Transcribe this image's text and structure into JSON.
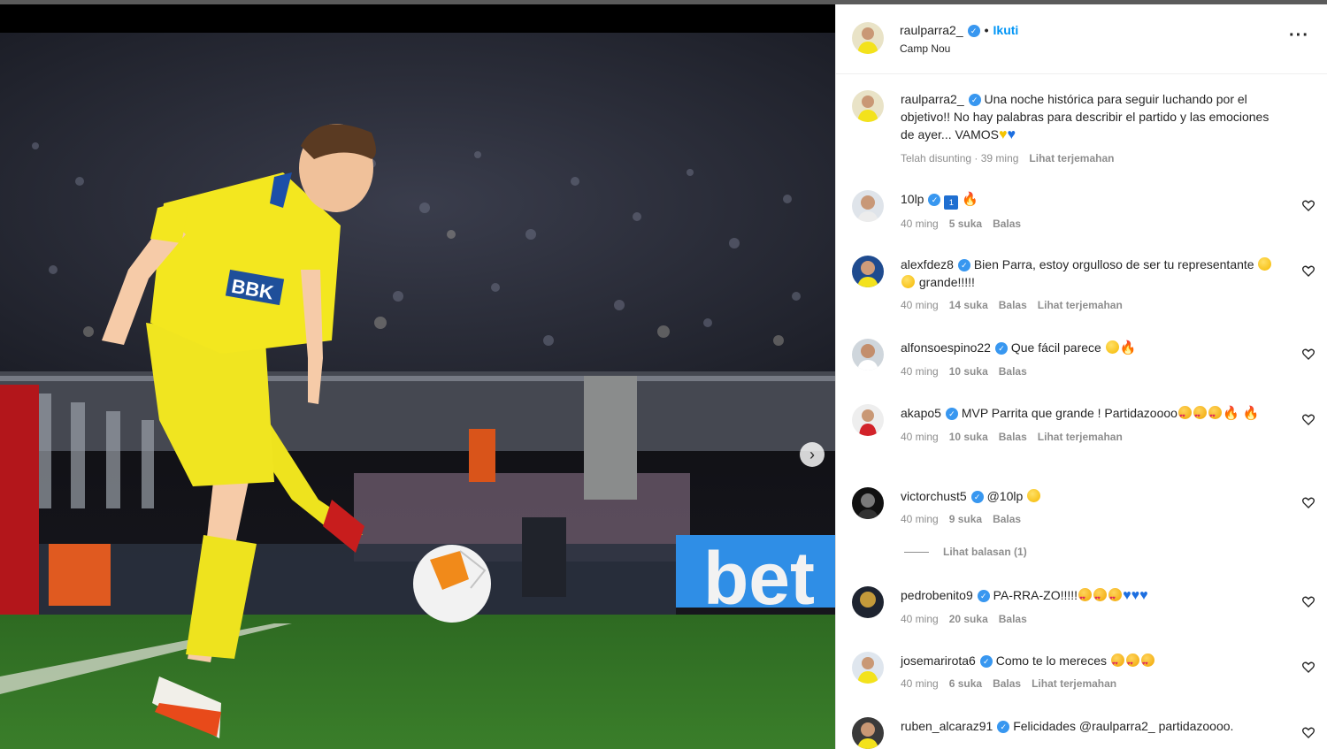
{
  "post": {
    "username": "raulparra2_",
    "follow_label": "Ikuti",
    "location": "Camp Nou",
    "caption": "Una noche histórica para seguir luchando por el objetivo!! No hay palabras para describir el partido y las emociones de ayer... VAMOS",
    "caption_meta_edited": "Telah disunting · 39 ming",
    "caption_translate": "Lihat terjemahan"
  },
  "media": {
    "next_icon": "chevron-right-icon",
    "sponsor_text": "bet"
  },
  "comments": [
    {
      "user": "10lp",
      "text": "",
      "time": "40 ming",
      "likes": "5 suka",
      "reply": "Balas",
      "translate": ""
    },
    {
      "user": "alexfdez8",
      "text": "Bien Parra, estoy orgulloso de ser tu representante",
      "text2": "grande!!!!!",
      "time": "40 ming",
      "likes": "14 suka",
      "reply": "Balas",
      "translate": "Lihat terjemahan"
    },
    {
      "user": "alfonsoespino22",
      "text": "Que fácil parece",
      "time": "40 ming",
      "likes": "10 suka",
      "reply": "Balas",
      "translate": ""
    },
    {
      "user": "akapo5",
      "text": "MVP Parrita que grande ! Partidazoooo",
      "time": "40 ming",
      "likes": "10 suka",
      "reply": "Balas",
      "translate": "Lihat terjemahan"
    },
    {
      "user": "victorchust5",
      "text": "@10lp",
      "time": "40 ming",
      "likes": "9 suka",
      "reply": "Balas",
      "translate": "",
      "view_replies": "Lihat balasan (1)"
    },
    {
      "user": "pedrobenito9",
      "text": "PA-RRA-ZO!!!!!",
      "time": "40 ming",
      "likes": "20 suka",
      "reply": "Balas",
      "translate": ""
    },
    {
      "user": "josemarirota6",
      "text": "Como te lo mereces",
      "time": "40 ming",
      "likes": "6 suka",
      "reply": "Balas",
      "translate": "Lihat terjemahan"
    },
    {
      "user": "ruben_alcaraz91",
      "text": "Felicidades @raulparra2_ partidazoooo.",
      "time": "",
      "likes": "",
      "reply": "",
      "translate": ""
    }
  ],
  "colors": {
    "accent": "#0095f6",
    "verified": "#3897f0",
    "muted": "#8e8e8e",
    "jersey": "#f3e51f"
  }
}
